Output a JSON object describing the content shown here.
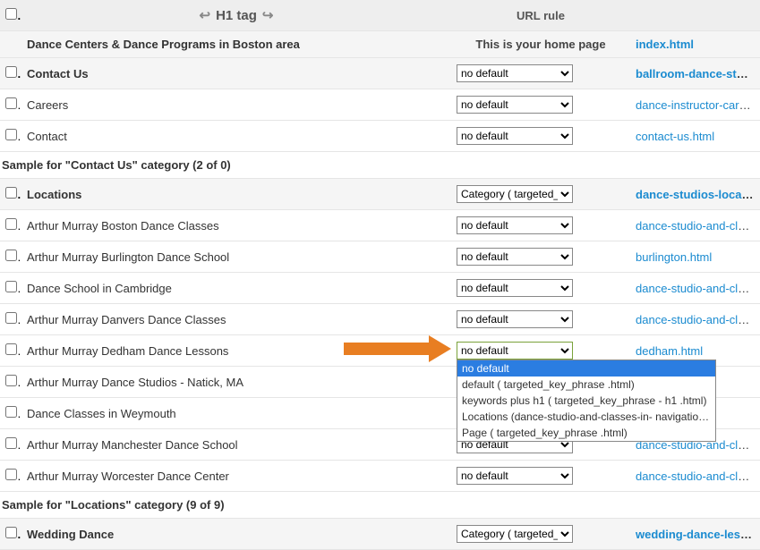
{
  "headers": {
    "h1": "H1 tag",
    "rule": "URL rule"
  },
  "home_row": {
    "title": "Dance Centers & Dance Programs in Boston area",
    "rule_text": "This is your home page",
    "url": "index.html"
  },
  "select_default": "no default",
  "select_category": "Category ( targeted_key_phrase .html)",
  "section_contact": {
    "header": {
      "title": "Contact Us",
      "url": "ballroom-dance-studios-in-boston"
    },
    "rows": [
      {
        "title": "Careers",
        "url": "dance-instructor-careers-in-boston"
      },
      {
        "title": "Contact",
        "url": "contact-us.html"
      }
    ],
    "sample": "Sample for \"Contact Us\" category (2 of 0)"
  },
  "section_locations": {
    "header": {
      "title": "Locations",
      "url": "dance-studios-locations-in-boston"
    },
    "rows": [
      {
        "title": "Arthur Murray Boston Dance Classes",
        "url": "dance-studio-and-classes-in-boston"
      },
      {
        "title": "Arthur Murray Burlington Dance School",
        "url": "burlington.html"
      },
      {
        "title": "Dance School in Cambridge",
        "url": "dance-studio-and-classes-in-cambridge"
      },
      {
        "title": "Arthur Murray Danvers Dance Classes",
        "url": "dance-studio-and-classes-in-danvers"
      },
      {
        "title": "Arthur Murray Dedham Dance Lessons",
        "url": "dedham.html",
        "open": true
      },
      {
        "title": "Arthur Murray Dance Studios - Natick, MA",
        "url": ""
      },
      {
        "title": "Dance Classes in Weymouth",
        "url": ""
      },
      {
        "title": "Arthur Murray Manchester Dance School",
        "url": "dance-studio-and-classes-in-manchester"
      },
      {
        "title": "Arthur Murray Worcester Dance Center",
        "url": "dance-studio-and-classes-in-worcester"
      }
    ],
    "sample": "Sample for \"Locations\" category (9 of 9)"
  },
  "section_wedding": {
    "header": {
      "title": "Wedding Dance",
      "url": "wedding-dance-lessons-and-classes"
    }
  },
  "dropdown_options": [
    "no default",
    "default ( targeted_key_phrase .html)",
    "keywords plus h1 ( targeted_key_phrase - h1 .html)",
    "Locations (dance-studio-and-classes-in- navigation_label -ma.html)",
    "Page ( targeted_key_phrase .html)"
  ]
}
